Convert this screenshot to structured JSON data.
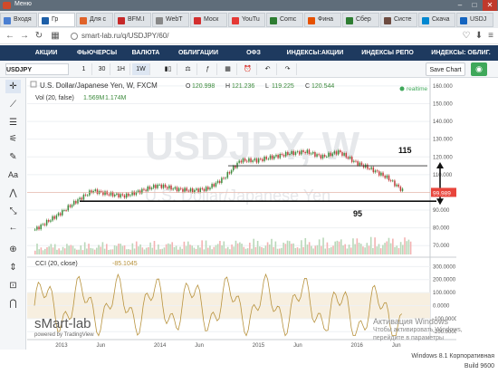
{
  "window": {
    "menu_label": "Меню"
  },
  "tabs": [
    {
      "label": "Входя",
      "color": "#4b7fd1"
    },
    {
      "label": "Гр",
      "color": "#1e5fa8"
    },
    {
      "label": "Для с",
      "color": "#e0632a"
    },
    {
      "label": "BFM.I",
      "color": "#c62828"
    },
    {
      "label": "WebT",
      "color": "#888888"
    },
    {
      "label": "Моск",
      "color": "#d32f2f"
    },
    {
      "label": "YouTu",
      "color": "#e53935"
    },
    {
      "label": "Comc",
      "color": "#2e7d32"
    },
    {
      "label": "Фина",
      "color": "#e65100"
    },
    {
      "label": "Сбер",
      "color": "#2e7d32"
    },
    {
      "label": "Систе",
      "color": "#6d4c41"
    },
    {
      "label": "Скача",
      "color": "#0288d1"
    },
    {
      "label": "USDJ",
      "color": "#1565c0"
    }
  ],
  "address": {
    "url": "smart-lab.ru/q/USDJPY/60/"
  },
  "menu": [
    "АКЦИИ",
    "ФЬЮЧЕРСЫ",
    "ВАЛЮТА",
    "ОБЛИГАЦИИ",
    "ОФЗ",
    "ИНДЕКСЫ:АКЦИИ",
    "ИНДЕКСЫ РЕПО",
    "ИНДЕКСЫ: ОБЛИГ."
  ],
  "toolbar": {
    "symbol": "USDJPY",
    "intervals": [
      "1",
      "30",
      "1H",
      "1W"
    ],
    "save_label": "Save Chart"
  },
  "chart": {
    "legend_title": "U.S. Dollar/Japanese Yen, W, FXCM",
    "ohlc": {
      "o_label": "O",
      "o": "120.998",
      "h_label": "H",
      "h": "121.236",
      "l_label": "L",
      "l": "119.225",
      "c_label": "C",
      "c": "120.544"
    },
    "vol_label": "Vol (20, false)",
    "vol_1": "1.569M",
    "vol_2": "1.174M",
    "realtime": "realtime",
    "watermark": "USDJPY, W",
    "watermark_sub": "U.S. Dollar/Japanese Yen",
    "annot_top": "115",
    "annot_bottom": "95",
    "price_badge": "99.989",
    "cci_label": "CCI (20, close)",
    "cci_value": "-85.1045",
    "brand": "sMart-lab",
    "powered": "powered by TradingView",
    "price_ticks": [
      "160.000",
      "150.000",
      "140.000",
      "130.000",
      "120.000",
      "110.000",
      "100.000",
      "90.000",
      "80.000",
      "70.000"
    ],
    "cci_ticks": [
      "300.0000",
      "200.0000",
      "100.0000",
      "0.0000",
      "-100.0000",
      "-200.0000"
    ],
    "x_ticks": [
      "2013",
      "Jun",
      "2014",
      "Jun",
      "2015",
      "Jun",
      "2016",
      "Jun"
    ]
  },
  "chart_data": {
    "type": "line",
    "title": "U.S. Dollar/Japanese Yen, W, FXCM",
    "x": [
      "2012-10",
      "2013-01",
      "2013-03",
      "2013-05",
      "2013-07",
      "2013-09",
      "2013-11",
      "2014-01",
      "2014-03",
      "2014-05",
      "2014-07",
      "2014-09",
      "2014-11",
      "2015-01",
      "2015-03",
      "2015-05",
      "2015-07",
      "2015-09",
      "2015-11",
      "2016-01",
      "2016-03",
      "2016-05",
      "2016-07"
    ],
    "series": [
      {
        "values": [
          79,
          88,
          95,
          101,
          99,
          98,
          101,
          104,
          102,
          101,
          102,
          108,
          118,
          118,
          120,
          122,
          123,
          120,
          123,
          117,
          113,
          108,
          100
        ]
      }
    ],
    "ylim": [
      65,
      162
    ],
    "cci_ylim": [
      -240,
      330
    ],
    "levels": [
      {
        "label": "115",
        "value": 115
      },
      {
        "label": "95",
        "value": 95
      }
    ]
  },
  "watermark": {
    "line1": "Активация Windows",
    "line2": "Чтобы активировать Windows,",
    "line3": "перейдите в параметры"
  },
  "taskbar": {
    "os": "Windows 8.1 Корпоративная",
    "build": "Build 9600"
  },
  "colors": {
    "menu_bg": "#1e3a5f",
    "up": "#3c8a3c",
    "down": "#c23b3b",
    "cci": "#b8933e",
    "badge": "#e8453c"
  }
}
